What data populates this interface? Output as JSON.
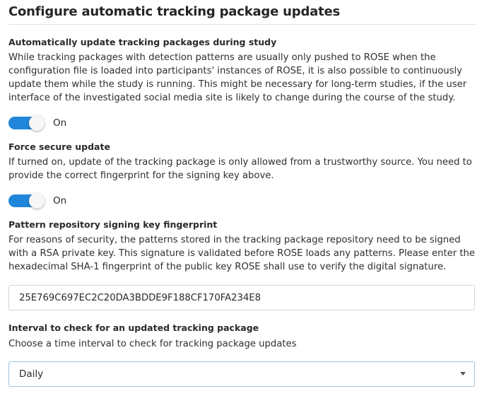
{
  "header": {
    "title": "Configure automatic tracking package updates"
  },
  "auto_update": {
    "label": "Automatically update tracking packages during study",
    "description": "While tracking packages with detection patterns are usually only pushed to ROSE when the configuration file is loaded into participants' instances of ROSE, it is also possible to continuously update them while the study is running. This might be necessary for long-term studies, if the user interface of the investigated social media site is likely to change during the course of the study.",
    "toggle_state": "On",
    "enabled": true
  },
  "secure_update": {
    "label": "Force secure update",
    "description": "If turned on, update of the tracking package is only allowed from a trustworthy source. You need to provide the correct fingerprint for the signing key above.",
    "toggle_state": "On",
    "enabled": true
  },
  "fingerprint": {
    "label": "Pattern repository signing key fingerprint",
    "description": "For reasons of security, the patterns stored in the tracking package repository need to be signed with a RSA private key. This signature is validated before ROSE loads any patterns. Please enter the hexadecimal SHA-1 fingerprint of the public key ROSE shall use to verify the digital signature.",
    "value": "25E769C697EC2C20DA3BDDE9F188CF170FA234E8"
  },
  "interval": {
    "label": "Interval to check for an updated tracking package",
    "description": "Choose a time interval to check for tracking package updates",
    "selected": "Daily"
  },
  "colors": {
    "accent": "#1f86d9",
    "select_border": "#9fc4e0"
  }
}
